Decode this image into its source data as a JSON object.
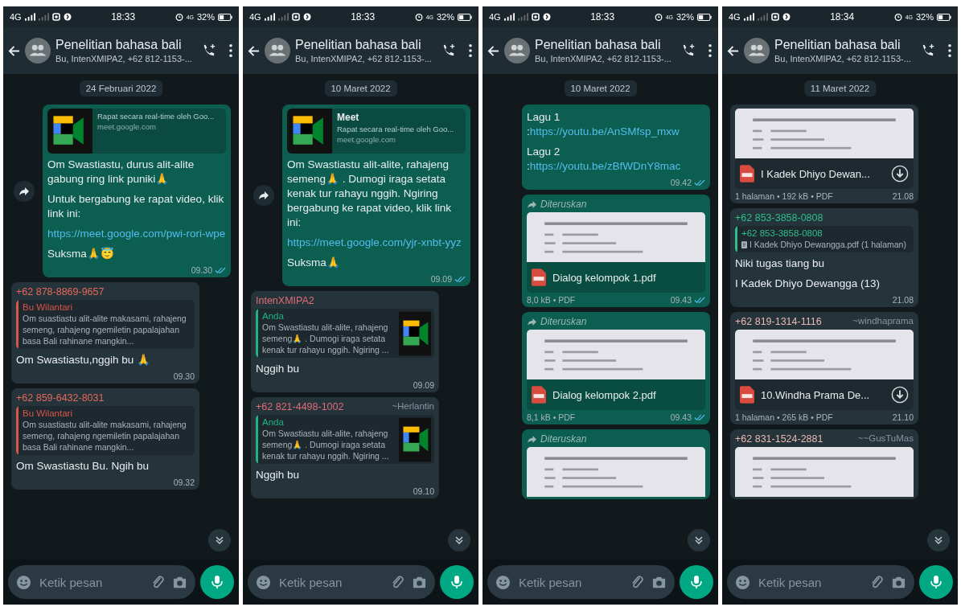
{
  "panels": [
    {
      "status_bar": {
        "network": "4G",
        "time": "18:33",
        "network_small": "4G",
        "battery": "32%"
      },
      "header": {
        "title": "Penelitian bahasa bali",
        "subtitle": "Bu, IntenXMIPA2, +62 812-1153-..."
      },
      "date_chip": "24 Februari 2022",
      "messages": [
        {
          "outgoing": true,
          "share_button": true,
          "preview": {
            "description": "Rapat secara real-time oleh Goo...",
            "domain": "meet.google.com"
          },
          "paragraphs": [
            {
              "text": "Om Swastiastu, durus alit-alite gabung ring link puniki🙏"
            },
            {
              "text": "Untuk bergabung ke rapat video, klik link ini:"
            },
            {
              "link": "https://meet.google.com/pwi-rori-wpe"
            },
            {
              "text": "Suksma🙏😇"
            }
          ],
          "time": "09.30",
          "read": true
        },
        {
          "outgoing": false,
          "sender": {
            "name": "+62 878-8869-9657",
            "color": "#e8675a"
          },
          "quote": {
            "author": "Bu Wilantari",
            "color": "#d9564a",
            "text": "Om suastiastu alit-alite makasami, rahajeng semeng, rahajeng ngemiletin papalajahan basa Bali rahinane mangkin..."
          },
          "paragraphs": [
            {
              "text": "Om Swastiastu,nggih bu 🙏"
            }
          ],
          "time": "09.30"
        },
        {
          "outgoing": false,
          "sender": {
            "name": "+62 859-6432-8031",
            "color": "#e8675a"
          },
          "quote": {
            "author": "Bu Wilantari",
            "color": "#d9564a",
            "text": "Om suastiastu alit-alite makasami, rahajeng semeng, rahajeng ngemiletin papalajahan basa Bali rahinane mangkin..."
          },
          "paragraphs": [
            {
              "text": "Om Swastiastu Bu. Ngih bu"
            }
          ],
          "time": "09.32"
        }
      ],
      "composer": {
        "placeholder": "Ketik pesan"
      }
    },
    {
      "status_bar": {
        "network": "4G",
        "time": "18:33",
        "network_small": "4G",
        "battery": "32%"
      },
      "header": {
        "title": "Penelitian bahasa bali",
        "subtitle": "Bu, IntenXMIPA2, +62 812-1153-..."
      },
      "date_chip": "10 Maret 2022",
      "messages": [
        {
          "outgoing": true,
          "share_button": true,
          "preview": {
            "title": "Meet",
            "description": "Rapat secara real-time oleh Goo...",
            "domain": "meet.google.com"
          },
          "paragraphs": [
            {
              "text": "Om Swastiastu alit-alite, rahajeng semeng🙏 . Dumogi iraga setata kenak tur rahayu nggih. Ngiring bergabung ke rapat video, klik link ini:"
            },
            {
              "link": "https://meet.google.com/yjr-xnbt-yyz"
            },
            {
              "text": "Suksma🙏"
            }
          ],
          "time": "09.09",
          "read": true
        },
        {
          "outgoing": false,
          "sender": {
            "name": "IntenXMIPA2",
            "color": "#e06c75"
          },
          "quote": {
            "author": "Anda",
            "color": "#21b37e",
            "text": "Om Swastiastu alit-alite, rahajeng semeng🙏 . Dumogi iraga setata kenak tur rahayu nggih. Ngiring ...",
            "thumbnail": true
          },
          "paragraphs": [
            {
              "text": "Nggih bu"
            }
          ],
          "time": "09.09"
        },
        {
          "outgoing": false,
          "sender": {
            "name": "+62 821-4498-1002",
            "color": "#e06c75",
            "alias": "~Herlantin"
          },
          "quote": {
            "author": "Anda",
            "color": "#21b37e",
            "text": "Om Swastiastu alit-alite, rahajeng semeng🙏 . Dumogi iraga setata kenak tur rahayu nggih. Ngiring ...",
            "thumbnail": true
          },
          "paragraphs": [
            {
              "text": "Nggih bu"
            }
          ],
          "time": "09.10"
        }
      ],
      "composer": {
        "placeholder": "Ketik pesan"
      }
    },
    {
      "status_bar": {
        "network": "4G",
        "time": "18:33",
        "network_small": "4G",
        "battery": "32%"
      },
      "header": {
        "title": "Penelitian bahasa bali",
        "subtitle": "Bu, IntenXMIPA2, +62 812-1153-..."
      },
      "date_chip": "10 Maret 2022",
      "messages": [
        {
          "outgoing": true,
          "paragraphs": [
            {
              "text": "Lagu 1 :",
              "link": "https://youtu.be/AnSMfsp_mxw"
            },
            {
              "text": "Lagu 2 :",
              "link": "https://youtu.be/zBfWDnY8mac"
            }
          ],
          "time": "09.42",
          "read": true
        },
        {
          "outgoing": true,
          "forwarded_label": "Diteruskan",
          "document": {
            "name": "Dialog kelompok 1.pdf",
            "meta": "8,0 kB • PDF"
          },
          "time": "09.43",
          "read": true
        },
        {
          "outgoing": true,
          "forwarded_label": "Diteruskan",
          "document": {
            "name": "Dialog kelompok 2.pdf",
            "meta": "8,1 kB • PDF"
          },
          "time": "09.43",
          "read": true
        },
        {
          "outgoing": true,
          "forwarded_label": "Diteruskan"
        }
      ],
      "composer": {
        "placeholder": "Ketik pesan"
      }
    },
    {
      "status_bar": {
        "network": "4G",
        "time": "18:34",
        "network_small": "4G",
        "battery": "32%"
      },
      "header": {
        "title": "Penelitian bahasa bali",
        "subtitle": "Bu, IntenXMIPA2, +62 812-1153-..."
      },
      "date_chip": "11 Maret 2022",
      "messages": [
        {
          "outgoing": false,
          "document": {
            "name": "I Kadek Dhiyo Dewan...",
            "download": true,
            "meta": "1 halaman • 192 kB • PDF"
          },
          "time": "21.08"
        },
        {
          "outgoing": false,
          "sender": {
            "name": "+62 853-3858-0808",
            "color": "#2fbf8a"
          },
          "quote": {
            "author": "+62 853-3858-0808",
            "color": "#2fbf8a",
            "text": "I Kadek Dhiyo Dewangga.pdf (1 halaman)",
            "attachment": true
          },
          "paragraphs": [
            {
              "text": "Niki tugas tiang bu"
            },
            {
              "text": "I Kadek Dhiyo Dewangga (13)"
            }
          ],
          "time": "21.08"
        },
        {
          "outgoing": false,
          "sender": {
            "name": "+62 819-1314-1116",
            "color": "#e8b9b0",
            "alias": "~windhaprama"
          },
          "document": {
            "name": "10.Windha Prama De...",
            "download": true,
            "meta": "1 halaman • 265 kB • PDF"
          },
          "time": "21.10"
        },
        {
          "outgoing": false,
          "sender": {
            "name": "+62 831-1524-2881",
            "color": "#e8b9b0",
            "alias": "~~GusTuMas"
          }
        }
      ],
      "composer": {
        "placeholder": "Ketik pesan"
      }
    }
  ]
}
